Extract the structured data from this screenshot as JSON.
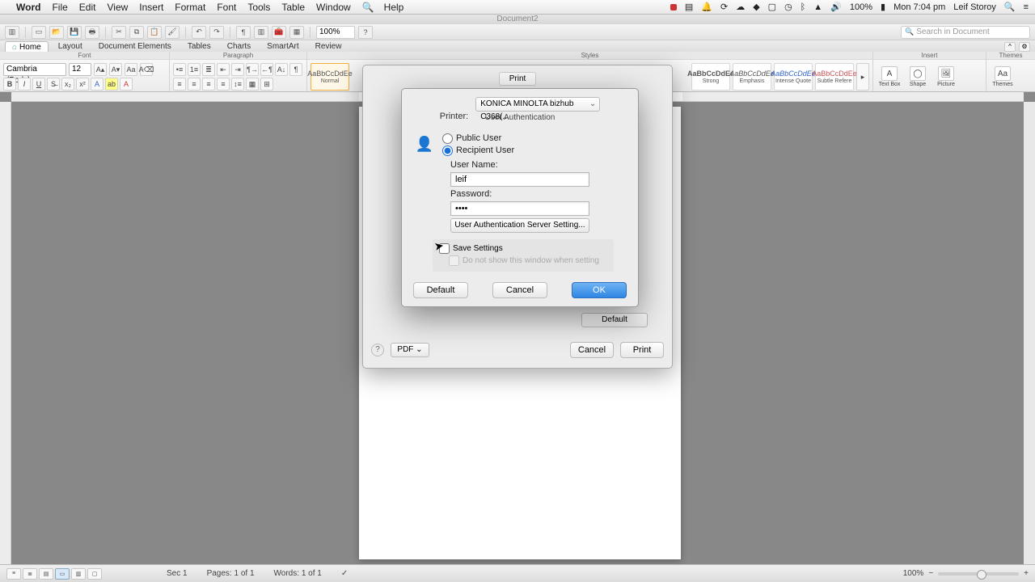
{
  "menubar": {
    "app": "Word",
    "items": [
      "File",
      "Edit",
      "View",
      "Insert",
      "Format",
      "Font",
      "Tools",
      "Table",
      "Window",
      "Help"
    ],
    "status": {
      "battery": "100%",
      "time": "Mon 7:04 pm",
      "user": "Leif Storoy"
    }
  },
  "window": {
    "title": "Document2"
  },
  "toolbar": {
    "zoom": "100%",
    "search_placeholder": "Search in Document"
  },
  "ribbon": {
    "tabs": [
      "Home",
      "Layout",
      "Document Elements",
      "Tables",
      "Charts",
      "SmartArt",
      "Review"
    ],
    "groups": {
      "font": "Font",
      "paragraph": "Paragraph",
      "styles": "Styles",
      "insert": "Insert",
      "themes": "Themes"
    },
    "font": {
      "name": "Cambria (Body)",
      "size": "12"
    },
    "styles": [
      {
        "preview": "AaBbCcDdEe",
        "name": "Normal"
      },
      {
        "preview": "AaBbCcDdEe",
        "name": "Strong"
      },
      {
        "preview": "AaBbCcDdEe",
        "name": "Emphasis"
      },
      {
        "preview": "AaBbCcDdEe",
        "name": "Intense Quote"
      },
      {
        "preview": "AaBbCcDdEe",
        "name": "Subtle Refere"
      }
    ],
    "insert": [
      "Text Box",
      "Shape",
      "Picture",
      "Themes"
    ]
  },
  "status": {
    "section": "Sec 1",
    "pages_label": "Pages:",
    "pages": "1 of 1",
    "words_label": "Words:",
    "words": "1 of 1",
    "zoom": "100%"
  },
  "printdlg": {
    "tab": "Print",
    "default": "Default",
    "pdf": "PDF",
    "cancel": "Cancel",
    "print": "Print"
  },
  "auth": {
    "printer_label": "Printer:",
    "printer": "KONICA MINOLTA bizhub C368(...",
    "section": "User Authentication",
    "public_user": "Public User",
    "recipient_user": "Recipient User",
    "username_label": "User Name:",
    "username": "leif",
    "password_label": "Password:",
    "password": "••••",
    "server_btn": "User Authentication Server Setting...",
    "save_settings": "Save Settings",
    "no_window": "Do not show this window when setting",
    "default": "Default",
    "cancel": "Cancel",
    "ok": "OK"
  }
}
